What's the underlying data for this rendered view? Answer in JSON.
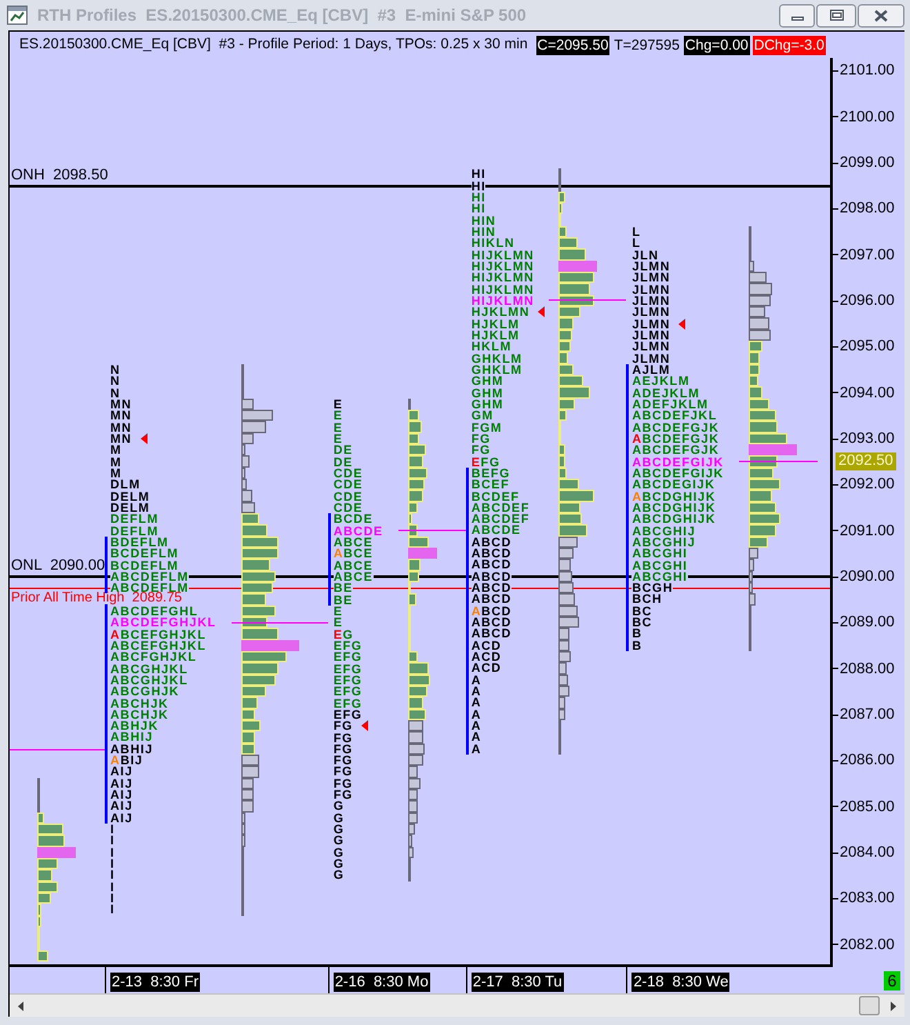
{
  "window": {
    "title": "RTH Profiles  ES.20150300.CME_Eq [CBV]  #3  E-mini S&P 500"
  },
  "header": {
    "info": "ES.20150300.CME_Eq [CBV]  #3 - Profile Period: 1 Days, TPOs: 0.25 x 30 min",
    "badges": [
      {
        "text": "C=2095.50",
        "kind": "dark"
      },
      {
        "text": "T=297595",
        "kind": "plain"
      },
      {
        "text": "Chg=0.00",
        "kind": "dark"
      },
      {
        "text": "DChg=-3.0",
        "kind": "alert"
      }
    ]
  },
  "chart": {
    "price_axis": {
      "labels": [
        "2101.00",
        "2100.00",
        "2099.00",
        "2098.00",
        "2097.00",
        "2096.00",
        "2095.00",
        "2094.00",
        "2093.00",
        "2092.00",
        "2091.00",
        "2090.00",
        "2089.00",
        "2088.00",
        "2087.00",
        "2086.00",
        "2085.00",
        "2084.00",
        "2083.00",
        "2082.00"
      ],
      "marker": {
        "text": "2092.50"
      }
    },
    "levels": [
      {
        "label": "ONH  2098.50",
        "kind": "overnight",
        "color": "#000000"
      },
      {
        "label": "ONL  2090.00",
        "kind": "overnight",
        "color": "#000000"
      },
      {
        "label": "Prior All Time High  2089.75",
        "kind": "annotation",
        "color": "#ff0000"
      }
    ],
    "sessions": [
      {
        "label": "2-13  8:30 Fr",
        "rows": [
          {
            "tpo": "N",
            "kind": "outside"
          },
          {
            "tpo": "N",
            "kind": "outside"
          },
          {
            "tpo": "N",
            "kind": "outside"
          },
          {
            "tpo": "MN",
            "kind": "outside"
          },
          {
            "tpo": "MN",
            "kind": "outside"
          },
          {
            "tpo": "MN",
            "kind": "outside"
          },
          {
            "tpo": "MN",
            "kind": "outside",
            "close_marker": true
          },
          {
            "tpo": "M",
            "kind": "outside"
          },
          {
            "tpo": "M",
            "kind": "outside"
          },
          {
            "tpo": "M",
            "kind": "outside"
          },
          {
            "tpo": "DLM",
            "kind": "outside"
          },
          {
            "tpo": "DELM",
            "kind": "outside"
          },
          {
            "tpo": "DELM",
            "kind": "outside"
          },
          {
            "tpo": "DEFLM",
            "kind": "value"
          },
          {
            "tpo": "DEFLM",
            "kind": "value"
          },
          {
            "tpo": "BDEFLM",
            "kind": "value"
          },
          {
            "tpo": "BCDEFLM",
            "kind": "value"
          },
          {
            "tpo": "BCDEFLM",
            "kind": "value"
          },
          {
            "tpo": "ABCDEFLM",
            "kind": "value"
          },
          {
            "tpo": "ABCDEFLM",
            "kind": "value"
          },
          {
            "tpo": "ABCDEFGHL",
            "kind": "value"
          },
          {
            "tpo": "ABCDEFGHJKL",
            "kind": "poc"
          },
          {
            "tpo": "ABCEFGHJKL",
            "kind": "value",
            "first_letter": {
              "color": "#ff0000"
            }
          },
          {
            "tpo": "ABCEFGHJKL",
            "kind": "value"
          },
          {
            "tpo": "ABCFGHJKL",
            "kind": "value"
          },
          {
            "tpo": "ABCGHJKL",
            "kind": "value"
          },
          {
            "tpo": "ABCGHJKL",
            "kind": "value"
          },
          {
            "tpo": "ABCGHJK",
            "kind": "value"
          },
          {
            "tpo": "ABCHJK",
            "kind": "value"
          },
          {
            "tpo": "ABCHJK",
            "kind": "value"
          },
          {
            "tpo": "ABHJK",
            "kind": "value"
          },
          {
            "tpo": "ABHIJ",
            "kind": "value"
          },
          {
            "tpo": "ABHIJ",
            "kind": "outside"
          },
          {
            "tpo": "ABIJ",
            "kind": "outside",
            "first_letter": {
              "color": "#ff8000"
            }
          },
          {
            "tpo": "AIJ",
            "kind": "outside"
          },
          {
            "tpo": "AIJ",
            "kind": "outside"
          },
          {
            "tpo": "AIJ",
            "kind": "outside"
          },
          {
            "tpo": "AIJ",
            "kind": "outside"
          },
          {
            "tpo": "AIJ",
            "kind": "outside"
          },
          {
            "tpo": "I",
            "kind": "outside"
          },
          {
            "tpo": "I",
            "kind": "outside"
          },
          {
            "tpo": "I",
            "kind": "outside"
          },
          {
            "tpo": "I",
            "kind": "outside"
          },
          {
            "tpo": "I",
            "kind": "outside"
          },
          {
            "tpo": "I",
            "kind": "outside"
          },
          {
            "tpo": "I",
            "kind": "outside"
          },
          {
            "tpo": "I",
            "kind": "outside"
          }
        ]
      },
      {
        "label": "2-16  8:30 Mo",
        "rows": [
          {
            "tpo": "E",
            "kind": "outside"
          },
          {
            "tpo": "E",
            "kind": "value"
          },
          {
            "tpo": "E",
            "kind": "value"
          },
          {
            "tpo": "E",
            "kind": "value"
          },
          {
            "tpo": "DE",
            "kind": "value"
          },
          {
            "tpo": "DE",
            "kind": "value"
          },
          {
            "tpo": "CDE",
            "kind": "value"
          },
          {
            "tpo": "CDE",
            "kind": "value"
          },
          {
            "tpo": "CDE",
            "kind": "value"
          },
          {
            "tpo": "CDE",
            "kind": "value"
          },
          {
            "tpo": "BCDE",
            "kind": "value"
          },
          {
            "tpo": "ABCDE",
            "kind": "poc"
          },
          {
            "tpo": "ABCE",
            "kind": "value"
          },
          {
            "tpo": "ABCE",
            "kind": "value",
            "first_letter": {
              "color": "#ff8000"
            }
          },
          {
            "tpo": "ABCE",
            "kind": "value"
          },
          {
            "tpo": "ABCE",
            "kind": "value"
          },
          {
            "tpo": "BE",
            "kind": "value"
          },
          {
            "tpo": "BE",
            "kind": "value"
          },
          {
            "tpo": "E",
            "kind": "value"
          },
          {
            "tpo": "E",
            "kind": "value"
          },
          {
            "tpo": "EG",
            "kind": "value",
            "first_letter": {
              "color": "#ff0000"
            }
          },
          {
            "tpo": "EFG",
            "kind": "value"
          },
          {
            "tpo": "EFG",
            "kind": "value"
          },
          {
            "tpo": "EFG",
            "kind": "value"
          },
          {
            "tpo": "EFG",
            "kind": "value"
          },
          {
            "tpo": "EFG",
            "kind": "value"
          },
          {
            "tpo": "EFG",
            "kind": "value"
          },
          {
            "tpo": "EFG",
            "kind": "outside"
          },
          {
            "tpo": "FG",
            "kind": "outside",
            "close_marker": true
          },
          {
            "tpo": "FG",
            "kind": "outside"
          },
          {
            "tpo": "FG",
            "kind": "outside"
          },
          {
            "tpo": "FG",
            "kind": "outside"
          },
          {
            "tpo": "FG",
            "kind": "outside"
          },
          {
            "tpo": "FG",
            "kind": "outside"
          },
          {
            "tpo": "FG",
            "kind": "outside"
          },
          {
            "tpo": "G",
            "kind": "outside"
          },
          {
            "tpo": "G",
            "kind": "outside"
          },
          {
            "tpo": "G",
            "kind": "outside"
          },
          {
            "tpo": "G",
            "kind": "outside"
          },
          {
            "tpo": "G",
            "kind": "outside"
          },
          {
            "tpo": "G",
            "kind": "outside"
          },
          {
            "tpo": "G",
            "kind": "outside"
          }
        ]
      },
      {
        "label": "2-17  8:30 Tu",
        "rows": [
          {
            "tpo": "HI",
            "kind": "outside"
          },
          {
            "tpo": "HI",
            "kind": "outside"
          },
          {
            "tpo": "HI",
            "kind": "value"
          },
          {
            "tpo": "HI",
            "kind": "value"
          },
          {
            "tpo": "HIN",
            "kind": "value"
          },
          {
            "tpo": "HIN",
            "kind": "value"
          },
          {
            "tpo": "HIKLN",
            "kind": "value"
          },
          {
            "tpo": "HIJKLMN",
            "kind": "value"
          },
          {
            "tpo": "HIJKLMN",
            "kind": "value"
          },
          {
            "tpo": "HIJKLMN",
            "kind": "value"
          },
          {
            "tpo": "HIJKLMN",
            "kind": "value"
          },
          {
            "tpo": "HIJKLMN",
            "kind": "poc"
          },
          {
            "tpo": "HJKLMN",
            "kind": "value",
            "close_marker": true
          },
          {
            "tpo": "HJKLM",
            "kind": "value"
          },
          {
            "tpo": "HJKLM",
            "kind": "value"
          },
          {
            "tpo": "HKLM",
            "kind": "value"
          },
          {
            "tpo": "GHKLM",
            "kind": "value"
          },
          {
            "tpo": "GHKLM",
            "kind": "value"
          },
          {
            "tpo": "GHM",
            "kind": "value"
          },
          {
            "tpo": "GHM",
            "kind": "value"
          },
          {
            "tpo": "GHM",
            "kind": "value"
          },
          {
            "tpo": "GM",
            "kind": "value"
          },
          {
            "tpo": "FGM",
            "kind": "value"
          },
          {
            "tpo": "FG",
            "kind": "value"
          },
          {
            "tpo": "FG",
            "kind": "value"
          },
          {
            "tpo": "EFG",
            "kind": "value",
            "first_letter": {
              "color": "#ff0000"
            }
          },
          {
            "tpo": "BEFG",
            "kind": "value"
          },
          {
            "tpo": "BCEF",
            "kind": "value"
          },
          {
            "tpo": "BCDEF",
            "kind": "value"
          },
          {
            "tpo": "ABCDEF",
            "kind": "value"
          },
          {
            "tpo": "ABCDEF",
            "kind": "value"
          },
          {
            "tpo": "ABCDE",
            "kind": "value"
          },
          {
            "tpo": "ABCD",
            "kind": "outside"
          },
          {
            "tpo": "ABCD",
            "kind": "outside"
          },
          {
            "tpo": "ABCD",
            "kind": "outside"
          },
          {
            "tpo": "ABCD",
            "kind": "outside"
          },
          {
            "tpo": "ABCD",
            "kind": "outside"
          },
          {
            "tpo": "ABCD",
            "kind": "outside"
          },
          {
            "tpo": "ABCD",
            "kind": "outside",
            "first_letter": {
              "color": "#ff8000"
            }
          },
          {
            "tpo": "ABCD",
            "kind": "outside"
          },
          {
            "tpo": "ABCD",
            "kind": "outside"
          },
          {
            "tpo": "ACD",
            "kind": "outside"
          },
          {
            "tpo": "ACD",
            "kind": "outside"
          },
          {
            "tpo": "ACD",
            "kind": "outside"
          },
          {
            "tpo": "A",
            "kind": "outside"
          },
          {
            "tpo": "A",
            "kind": "outside"
          },
          {
            "tpo": "A",
            "kind": "outside"
          },
          {
            "tpo": "A",
            "kind": "outside"
          },
          {
            "tpo": "A",
            "kind": "outside"
          },
          {
            "tpo": "A",
            "kind": "outside"
          },
          {
            "tpo": "A",
            "kind": "outside"
          }
        ]
      },
      {
        "label": "2-18  8:30 We",
        "rows": [
          {
            "tpo": "L",
            "kind": "outside"
          },
          {
            "tpo": "L",
            "kind": "outside"
          },
          {
            "tpo": "JLN",
            "kind": "outside"
          },
          {
            "tpo": "JLMN",
            "kind": "outside"
          },
          {
            "tpo": "JLMN",
            "kind": "outside"
          },
          {
            "tpo": "JLMN",
            "kind": "outside"
          },
          {
            "tpo": "JLMN",
            "kind": "outside"
          },
          {
            "tpo": "JLMN",
            "kind": "outside"
          },
          {
            "tpo": "JLMN",
            "kind": "outside",
            "close_marker": true
          },
          {
            "tpo": "JLMN",
            "kind": "outside"
          },
          {
            "tpo": "JLMN",
            "kind": "outside"
          },
          {
            "tpo": "JLMN",
            "kind": "outside"
          },
          {
            "tpo": "AJLM",
            "kind": "outside"
          },
          {
            "tpo": "AEJKLM",
            "kind": "value"
          },
          {
            "tpo": "ADEJKLM",
            "kind": "value"
          },
          {
            "tpo": "ADEFJKLM",
            "kind": "value"
          },
          {
            "tpo": "ABCDEFJKL",
            "kind": "value"
          },
          {
            "tpo": "ABCDEFGJK",
            "kind": "value"
          },
          {
            "tpo": "ABCDEFGJK",
            "kind": "value",
            "first_letter": {
              "color": "#ff0000"
            }
          },
          {
            "tpo": "ABCDEFGJK",
            "kind": "value"
          },
          {
            "tpo": "ABCDEFGIJK",
            "kind": "poc"
          },
          {
            "tpo": "ABCDEFGIJK",
            "kind": "value"
          },
          {
            "tpo": "ABCDEGIJK",
            "kind": "value"
          },
          {
            "tpo": "ABCDGHIJK",
            "kind": "value",
            "first_letter": {
              "color": "#ff8000"
            }
          },
          {
            "tpo": "ABCDGHIJK",
            "kind": "value"
          },
          {
            "tpo": "ABCDGHIJK",
            "kind": "value"
          },
          {
            "tpo": "ABCGHIJ",
            "kind": "value"
          },
          {
            "tpo": "ABCGHIJ",
            "kind": "value"
          },
          {
            "tpo": "ABCGHI",
            "kind": "value"
          },
          {
            "tpo": "ABCGHI",
            "kind": "value"
          },
          {
            "tpo": "ABCGHI",
            "kind": "value"
          },
          {
            "tpo": "BCGH",
            "kind": "outside"
          },
          {
            "tpo": "BCH",
            "kind": "outside"
          },
          {
            "tpo": "BC",
            "kind": "outside"
          },
          {
            "tpo": "BC",
            "kind": "outside"
          },
          {
            "tpo": "B",
            "kind": "outside"
          },
          {
            "tpo": "B",
            "kind": "outside"
          }
        ]
      }
    ]
  },
  "status": {
    "badge": "6"
  }
}
